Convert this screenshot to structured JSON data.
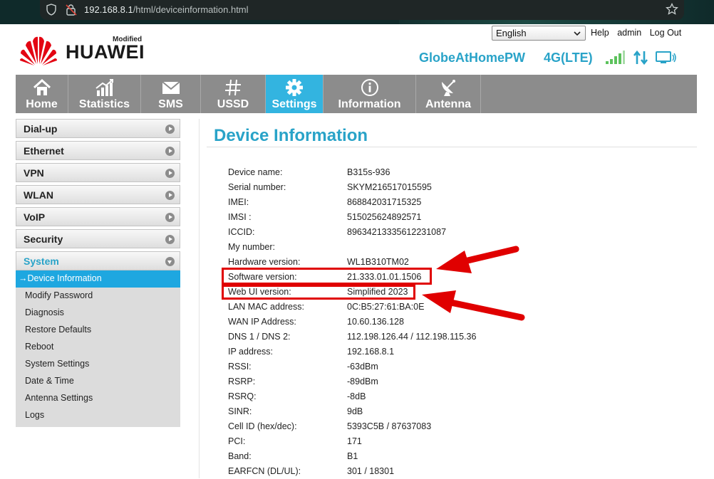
{
  "browser": {
    "url_host": "192.168.8.1",
    "url_path": "/html/deviceinformation.html"
  },
  "header": {
    "brand": "HUAWEI",
    "brand_badge": "Modified",
    "language": "English",
    "links": [
      "Help",
      "admin",
      "Log Out"
    ],
    "network_name": "GlobeAtHomePW",
    "network_type": "4G(LTE)"
  },
  "nav": {
    "items": [
      {
        "label": "Home",
        "icon": "home-icon"
      },
      {
        "label": "Statistics",
        "icon": "statistics-icon"
      },
      {
        "label": "SMS",
        "icon": "envelope-icon"
      },
      {
        "label": "USSD",
        "icon": "hash-icon"
      },
      {
        "label": "Settings",
        "icon": "gear-icon"
      },
      {
        "label": "Information",
        "icon": "info-icon"
      },
      {
        "label": "Antenna",
        "icon": "satellite-dish-icon"
      }
    ],
    "active": "Settings"
  },
  "sidebar": {
    "groups": [
      "Dial-up",
      "Ethernet",
      "VPN",
      "WLAN",
      "VoIP",
      "Security",
      "System"
    ],
    "open_group": "System",
    "subitems": [
      "Device Information",
      "Modify Password",
      "Diagnosis",
      "Restore Defaults",
      "Reboot",
      "System Settings",
      "Date & Time",
      "Antenna Settings",
      "Logs"
    ],
    "active_subitem_prefix": "→"
  },
  "content": {
    "title": "Device Information",
    "rows": [
      {
        "key": "Device name:",
        "value": "B315s-936"
      },
      {
        "key": "Serial number:",
        "value": "SKYM216517015595"
      },
      {
        "key": "IMEI:",
        "value": "868842031715325"
      },
      {
        "key": "IMSI :",
        "value": "515025624892571"
      },
      {
        "key": "ICCID:",
        "value": "89634213335612231087"
      },
      {
        "key": "My number:",
        "value": ""
      },
      {
        "key": "Hardware version:",
        "value": "WL1B310TM02"
      },
      {
        "key": "Software version:",
        "value": "21.333.01.01.1506"
      },
      {
        "key": "Web UI version:",
        "value": "Simplified 2023"
      },
      {
        "key": "LAN MAC address:",
        "value": "0C:B5:27:61:BA:0E"
      },
      {
        "key": "WAN IP Address:",
        "value": "10.60.136.128"
      },
      {
        "key": "DNS 1 / DNS 2:",
        "value": "112.198.126.44 / 112.198.115.36"
      },
      {
        "key": "IP address:",
        "value": "192.168.8.1"
      },
      {
        "key": "RSSI:",
        "value": "-63dBm"
      },
      {
        "key": "RSRP:",
        "value": "-89dBm"
      },
      {
        "key": "RSRQ:",
        "value": "-8dB"
      },
      {
        "key": "SINR:",
        "value": "9dB"
      },
      {
        "key": "Cell ID (hex/dec):",
        "value": "5393C5B / 87637083"
      },
      {
        "key": "PCI:",
        "value": "171"
      },
      {
        "key": "Band:",
        "value": "B1"
      },
      {
        "key": "EARFCN (DL/UL):",
        "value": "301 / 18301"
      }
    ]
  },
  "colors": {
    "accent": "#29a3c8",
    "nav_bg": "#8c8c8c",
    "nav_active": "#33b4e0",
    "highlight": "#e00000"
  }
}
